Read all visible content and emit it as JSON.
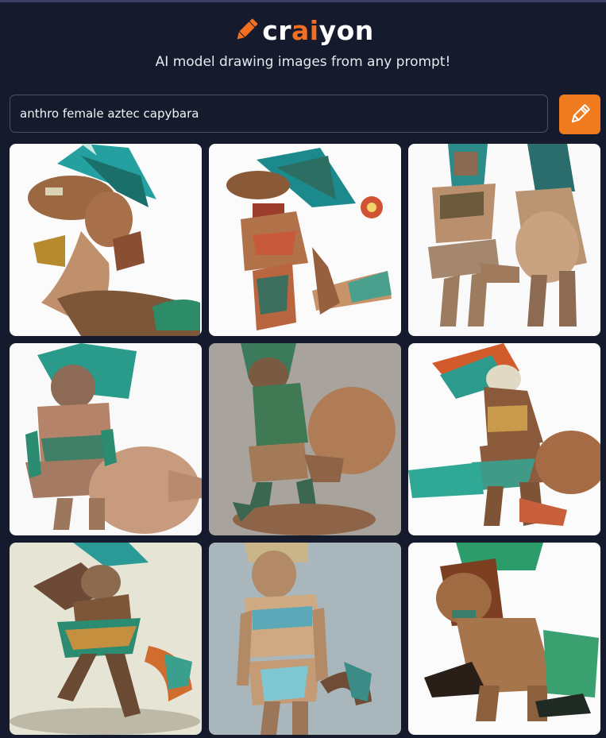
{
  "header": {
    "logo_icon": "pencil-icon",
    "logo_part1": "cr",
    "logo_part2": "ai",
    "logo_part3": "yon",
    "accent_color": "#f26f22",
    "subtitle": "AI model drawing images from any prompt!"
  },
  "search": {
    "value": "anthro female aztec capybara",
    "button_icon": "pencil-icon",
    "button_color": "#f07a1e"
  },
  "results": {
    "image_count": 9,
    "items": [
      {
        "bg": "#fbfbfb"
      },
      {
        "bg": "#fbfbfb"
      },
      {
        "bg": "#fafafa"
      },
      {
        "bg": "#f9f9f9"
      },
      {
        "bg": "#a8a49d"
      },
      {
        "bg": "#fbfbfb"
      },
      {
        "bg": "#e6e4d5"
      },
      {
        "bg": "#a9b7bd"
      },
      {
        "bg": "#fbfbfb"
      }
    ]
  }
}
